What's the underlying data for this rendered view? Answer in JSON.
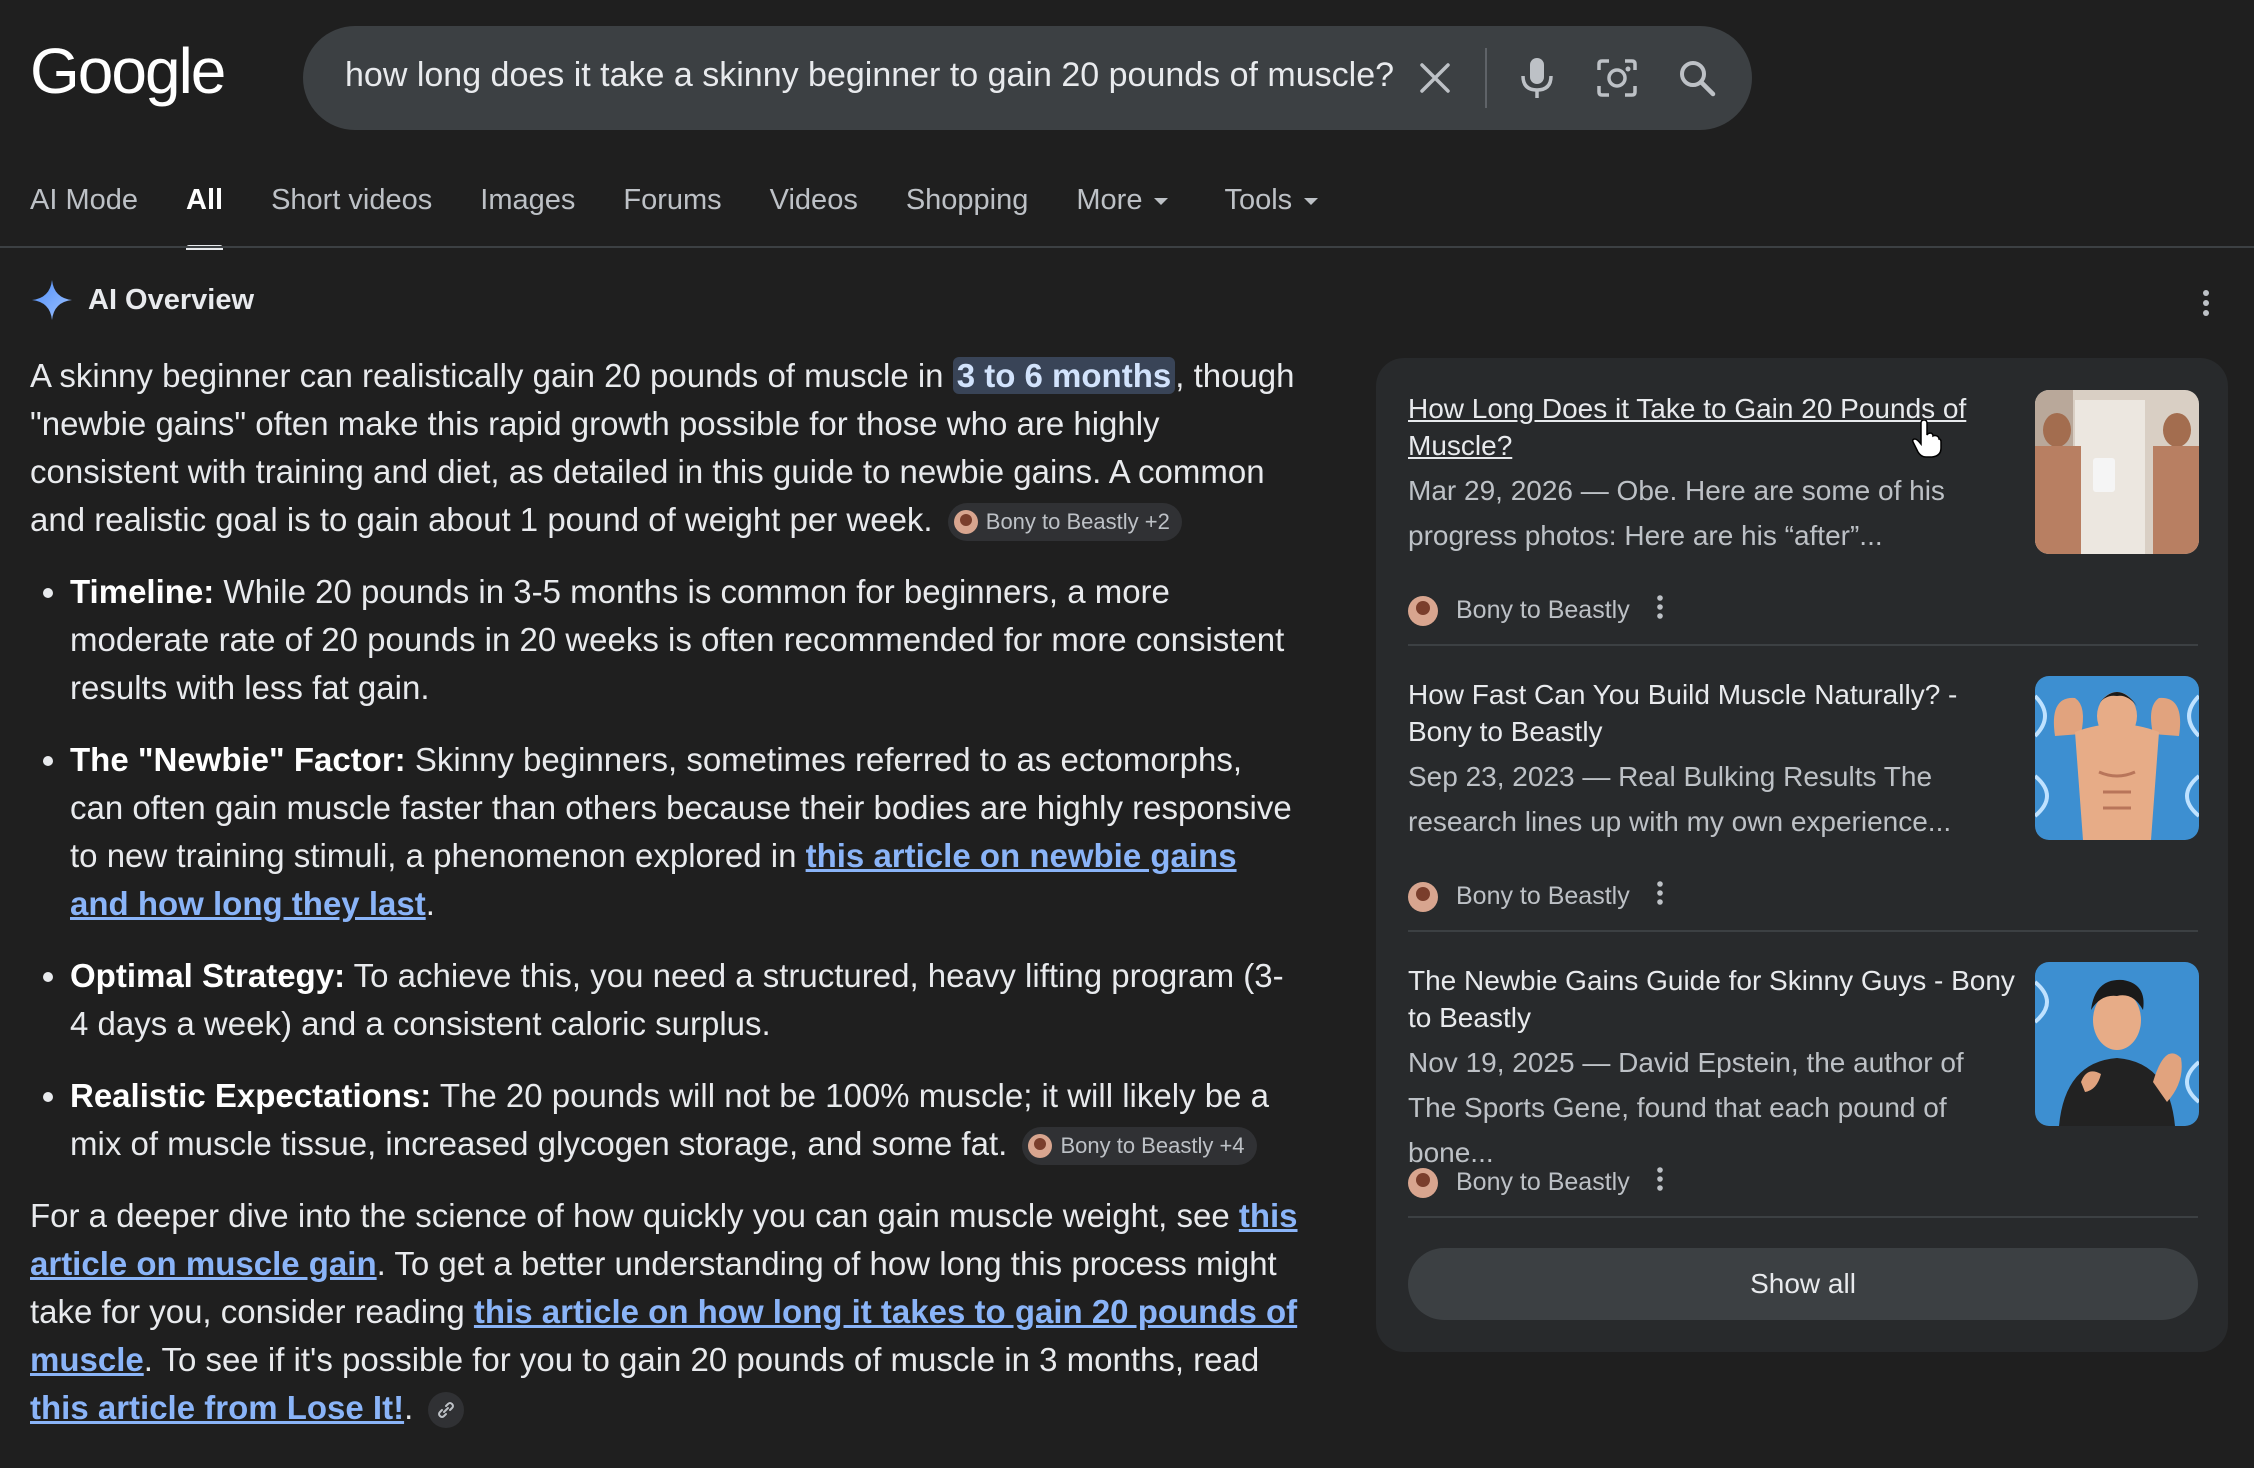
{
  "logo": "Google",
  "search": {
    "query": "how long does it take a skinny beginner to gain 20 pounds of muscle?",
    "icons": [
      "close-icon",
      "microphone-icon",
      "lens-icon",
      "search-icon"
    ]
  },
  "tabs": [
    {
      "label": "AI Mode",
      "active": false
    },
    {
      "label": "All",
      "active": true
    },
    {
      "label": "Short videos",
      "active": false
    },
    {
      "label": "Images",
      "active": false
    },
    {
      "label": "Forums",
      "active": false
    },
    {
      "label": "Videos",
      "active": false
    },
    {
      "label": "Shopping",
      "active": false
    },
    {
      "label": "More",
      "active": false
    },
    {
      "label": "Tools",
      "active": false
    }
  ],
  "ai_overview": {
    "title": "AI Overview",
    "intro_1": "A skinny beginner can realistically gain 20 pounds of muscle in ",
    "intro_highlight": "3 to 6 months",
    "intro_2": ", though \"newbie gains\" often make this rapid growth possible for those who are highly consistent with training and diet, as detailed in this guide to newbie gains. A common and realistic goal is to gain about 1 pound of weight per week.",
    "intro_chip": "Bony to Beastly +2",
    "bullets": [
      {
        "label": "Timeline:",
        "text": " While 20 pounds in 3-5 months is common for beginners, a more moderate rate of 20 pounds in 20 weeks is often recommended for more consistent results with less fat gain."
      },
      {
        "label": "The \"Newbie\" Factor:",
        "text": " Skinny beginners, sometimes referred to as ectomorphs, can often gain muscle faster than others because their bodies are highly responsive to new training stimuli, a phenomenon explored in ",
        "link": "this article on newbie gains and how long they last",
        "after": "."
      },
      {
        "label": "Optimal Strategy:",
        "text": " To achieve this, you need a structured, heavy lifting program (3-4 days a week) and a consistent caloric surplus."
      },
      {
        "label": "Realistic Expectations:",
        "text": " The 20 pounds will not be 100% muscle; it will likely be a mix of muscle tissue, increased glycogen storage, and some fat.",
        "chip": "Bony to Beastly +4"
      }
    ],
    "closing": {
      "t1": "For a deeper dive into the science of how quickly you can gain muscle weight, see ",
      "l1": "this article on muscle gain",
      "t2": ". To get a better understanding of how long this process might take for you, consider reading ",
      "l2": "this article on how long it takes to gain 20 pounds of muscle",
      "t3": ". To see if it's possible for you to gain 20 pounds of muscle in 3 months, read ",
      "l3": "this article from Lose It!",
      "t4": "."
    }
  },
  "sources": [
    {
      "title": "How Long Does it Take to Gain 20 Pounds of Muscle?",
      "snippet": "Mar 29, 2026 — Obe. Here are some of his progress photos: Here are his “after”...",
      "site": "Bony to Beastly"
    },
    {
      "title": "How Fast Can You Build Muscle Naturally? - Bony to Beastly",
      "snippet": "Sep 23, 2023 — Real Bulking Results The research lines up with my own experience...",
      "site": "Bony to Beastly"
    },
    {
      "title": "The Newbie Gains Guide for Skinny Guys - Bony to Beastly",
      "snippet": "Nov 19, 2025 — David Epstein, the author of The Sports Gene, found that each pound of bone...",
      "site": "Bony to Beastly"
    }
  ],
  "show_all": "Show all"
}
